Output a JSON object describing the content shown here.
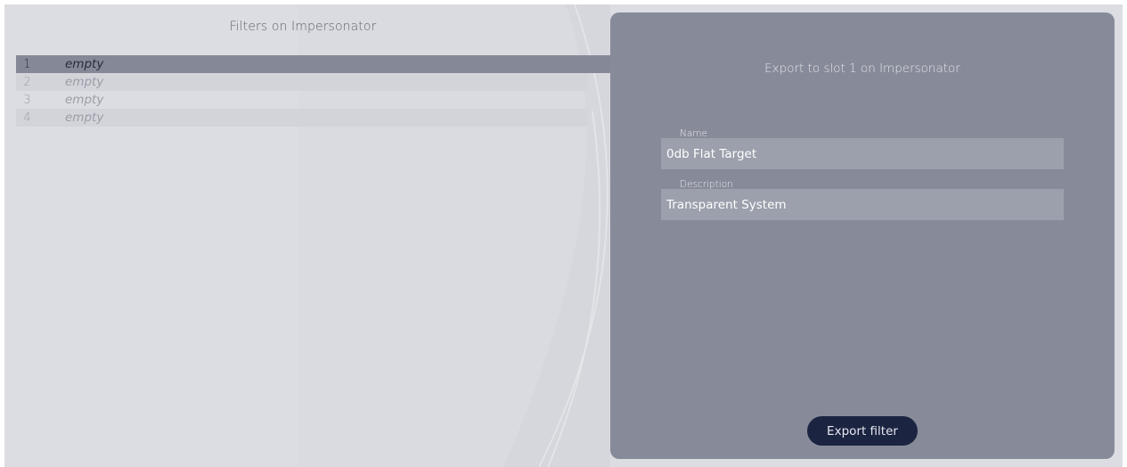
{
  "left_panel": {
    "title": "Filters on Impersonator",
    "slots": [
      {
        "number": "1",
        "name": "empty",
        "selected": true
      },
      {
        "number": "2",
        "name": "empty",
        "selected": false
      },
      {
        "number": "3",
        "name": "empty",
        "selected": false
      },
      {
        "number": "4",
        "name": "empty",
        "selected": false
      }
    ]
  },
  "export_panel": {
    "title": "Export to slot 1 on Impersonator",
    "name_label": "Name",
    "name_value": "0db Flat Target",
    "description_label": "Description",
    "description_value": "Transparent System",
    "export_button": "Export filter"
  },
  "colors": {
    "background": "#dcdde2",
    "panel": "#878b99",
    "selected_row": "#858997",
    "field": "#9ca0ac",
    "button": "#1b2441"
  }
}
